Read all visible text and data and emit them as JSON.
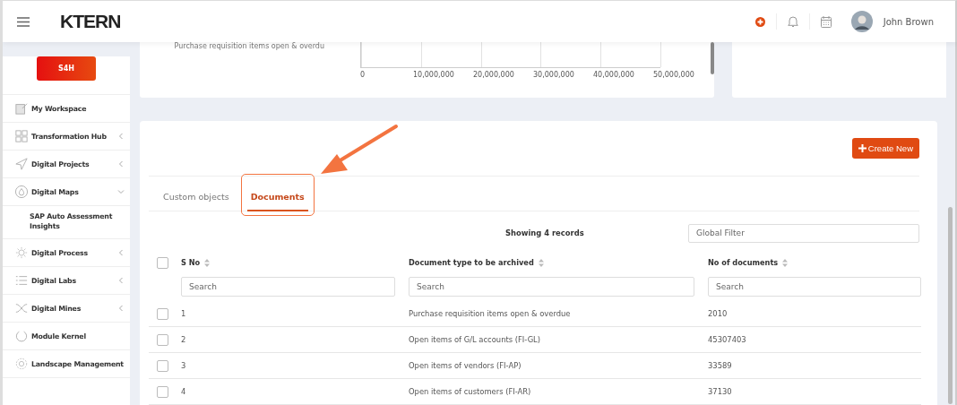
{
  "header": {
    "logo": "KTERN",
    "user": "John Brown"
  },
  "sidebar": {
    "badge": "S4H",
    "items": [
      {
        "label": "My Workspace",
        "kind": "link"
      },
      {
        "label": "Transformation Hub",
        "kind": "group",
        "expanded": false
      },
      {
        "label": "Digital Projects",
        "kind": "group",
        "expanded": false
      },
      {
        "label": "Digital Maps",
        "kind": "group",
        "expanded": true,
        "children": [
          {
            "label": "SAP Auto Assessment Insights"
          }
        ]
      },
      {
        "label": "Digital Process",
        "kind": "group",
        "expanded": false
      },
      {
        "label": "Digital Labs",
        "kind": "group",
        "expanded": false
      },
      {
        "label": "Digital Mines",
        "kind": "group",
        "expanded": false
      },
      {
        "label": "Module Kernel",
        "kind": "link"
      },
      {
        "label": "Landscape Management",
        "kind": "link"
      }
    ]
  },
  "chart_fragment": {
    "category_label": "Purchase requisition items open & overdu",
    "ticks": [
      "0",
      "10,000,000",
      "20,000,000",
      "30,000,000",
      "40,000,000",
      "50,000,000"
    ]
  },
  "create_button": "Create New",
  "tabs": [
    {
      "label": "Custom objects",
      "selected": false,
      "highlighted": false
    },
    {
      "label": "Documents",
      "selected": true,
      "highlighted": true
    }
  ],
  "records_text": "Showing 4 records",
  "global_filter": {
    "placeholder": "Global Filter"
  },
  "table": {
    "select_all_checked": false,
    "columns": [
      {
        "label": "S No",
        "filter_placeholder": "Search"
      },
      {
        "label": "Document type to be archived",
        "filter_placeholder": "Search"
      },
      {
        "label": "No of documents",
        "filter_placeholder": "Search"
      }
    ],
    "rows": [
      {
        "checked": false,
        "cells": [
          "1",
          "Purchase requisition items open & overdue",
          "2010"
        ]
      },
      {
        "checked": false,
        "cells": [
          "2",
          "Open items of G/L accounts (FI-GL)",
          "45307403"
        ]
      },
      {
        "checked": false,
        "cells": [
          "3",
          "Open items of vendors (FI-AP)",
          "33589"
        ]
      },
      {
        "checked": false,
        "cells": [
          "4",
          "Open items of customers (FI-AR)",
          "37130"
        ]
      }
    ]
  }
}
